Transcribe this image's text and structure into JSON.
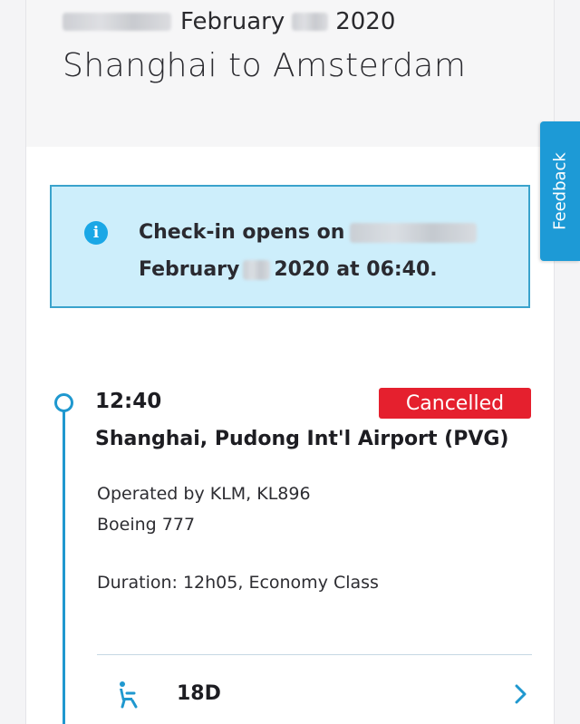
{
  "header": {
    "date_month": "February",
    "date_year": "2020",
    "route_title": "Shanghai to Amsterdam"
  },
  "checkin_notice": {
    "icon": "info-icon",
    "prefix": "Check-in opens on",
    "month": "February",
    "suffix": "2020 at 06:40."
  },
  "flight": {
    "departure_time": "12:40",
    "status": "Cancelled",
    "departure_airport": "Shanghai, Pudong Int'l Airport (PVG)",
    "operated_by": "Operated by KLM, KL896",
    "aircraft": "Boeing 777",
    "duration": "Duration: 12h05, Economy Class",
    "seat": "18D",
    "seat_icon": "seat-icon",
    "chevron_icon": "chevron-right-icon"
  },
  "feedback": {
    "label": "Feedback"
  },
  "colors": {
    "accent": "#1d9ad6",
    "status_cancelled": "#e5202e",
    "info_bg": "#cdeefb",
    "info_border": "#3aa3cc"
  }
}
